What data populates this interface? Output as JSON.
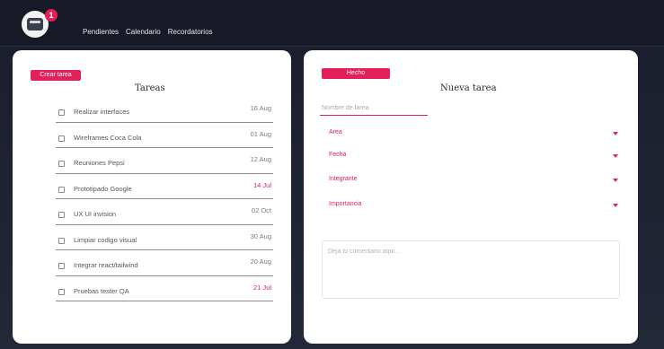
{
  "header": {
    "notification_count": "1",
    "nav": [
      "Pendientes",
      "Calendario",
      "Recordatorios"
    ]
  },
  "left": {
    "create_button": "Crear tarea",
    "title": "Tareas",
    "tasks": [
      {
        "name": "Realizar interfaces",
        "date": "16 Aug",
        "late": false
      },
      {
        "name": "Wireframes Coca Cola",
        "date": "01 Aug",
        "late": false
      },
      {
        "name": "Reuniones Pepsi",
        "date": "12 Aug",
        "late": false
      },
      {
        "name": "Prototipado Google",
        "date": "14 Jul",
        "late": true
      },
      {
        "name": "UX UI invision",
        "date": "02 Oct",
        "late": false
      },
      {
        "name": "Limpiar codigo visual",
        "date": "30 Aug",
        "late": false
      },
      {
        "name": "Integrar react/tailwind",
        "date": "20 Aug",
        "late": false
      },
      {
        "name": "Pruebas tester QA",
        "date": "21 Jul",
        "late": true
      }
    ]
  },
  "right": {
    "ready_button": "Hecho",
    "title": "Nueva tarea",
    "name_placeholder": "Nombre de tarea",
    "selects": [
      "Area",
      "Fecha",
      "Integrante",
      "Importancia"
    ],
    "comment_placeholder": "Deja tu comentario aqui..."
  },
  "colors": {
    "accent": "#e2205a",
    "background": "#1c2030",
    "panel": "#ffffff"
  }
}
